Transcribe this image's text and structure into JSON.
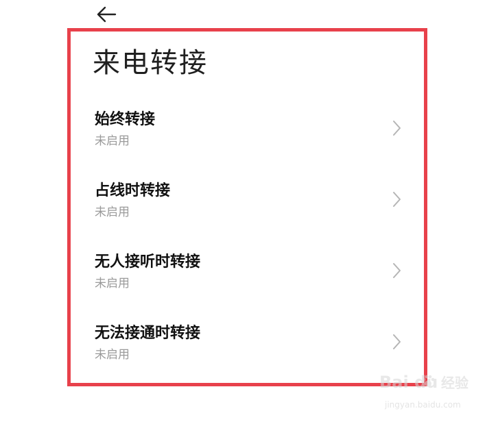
{
  "header": {
    "back_icon": "arrow-left-icon"
  },
  "page": {
    "title": "来电转接"
  },
  "items": [
    {
      "title": "始终转接",
      "status": "未启用",
      "icon": "chevron-right-icon"
    },
    {
      "title": "占线时转接",
      "status": "未启用",
      "icon": "chevron-right-icon"
    },
    {
      "title": "无人接听时转接",
      "status": "未启用",
      "icon": "chevron-right-icon"
    },
    {
      "title": "无法接通时转接",
      "status": "未启用",
      "icon": "chevron-right-icon"
    }
  ],
  "highlight": {
    "color": "#e8414b"
  },
  "watermark": {
    "logo": "Bai du",
    "brand": "经验",
    "url": "jingyan.baidu.com"
  }
}
